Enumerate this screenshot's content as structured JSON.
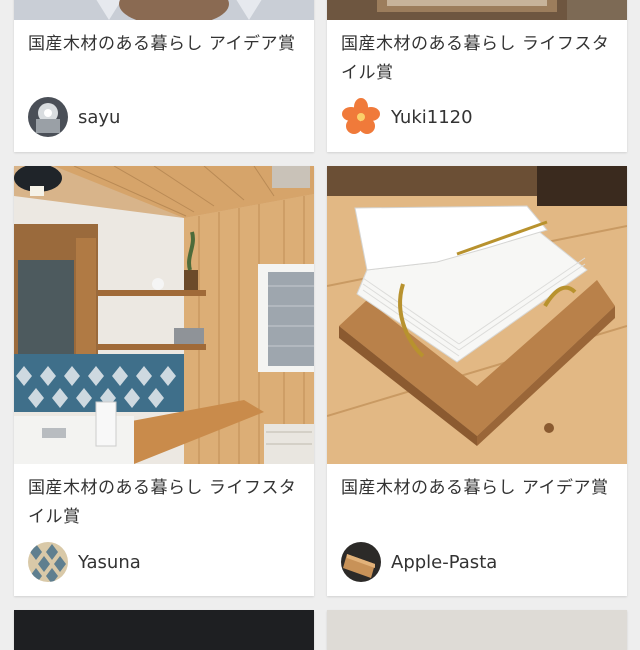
{
  "cards": [
    {
      "title": "国産木材のある暮らし アイデア賞",
      "user": "sayu"
    },
    {
      "title": "国産木材のある暮らし ライフスタイル賞",
      "user": "Yuki1120"
    },
    {
      "title": "国産木材のある暮らし ライフスタイル賞",
      "user": "Yasuna"
    },
    {
      "title": "国産木材のある暮らし アイデア賞",
      "user": "Apple-Pasta"
    }
  ],
  "colors": {
    "background": "#eeeeee",
    "card": "#ffffff",
    "text": "#333333"
  },
  "icons": [
    "sayu-avatar",
    "hibiscus-avatar",
    "tile-avatar",
    "wood-avatar"
  ]
}
